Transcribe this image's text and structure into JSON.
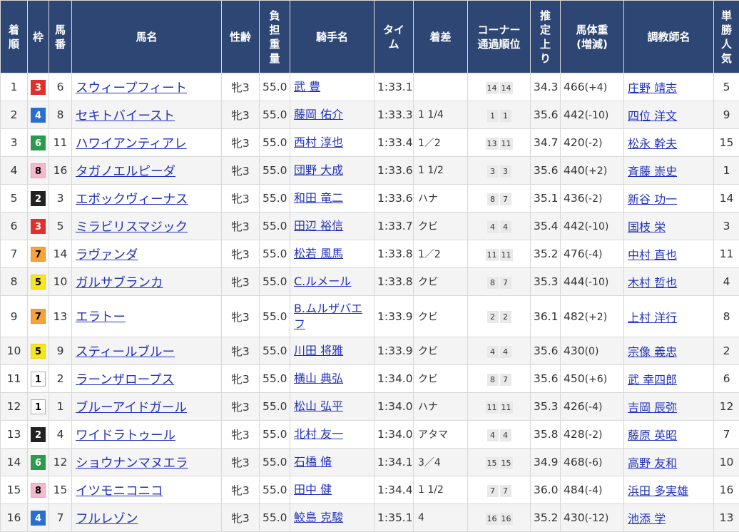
{
  "headers": {
    "rank": "着\n順",
    "waku": "枠",
    "umaban": "馬\n番",
    "horse": "馬名",
    "sexage": "性齢",
    "load": "負\n担\n重\n量",
    "jockey": "騎手名",
    "time": "タイ\nム",
    "margin": "着差",
    "corner": "コーナー\n通過順位",
    "last3f": "推\n定\n上\nり",
    "weight": "馬体重\n(増減)",
    "trainer": "調教師名",
    "pop": "単\n勝\n人\n気"
  },
  "rows": [
    {
      "rank": "1",
      "waku": "3",
      "umaban": "6",
      "horse": "スウィープフィート",
      "sexage": "牝3",
      "load": "55.0",
      "jockey": "武 豊",
      "time": "1:33.1",
      "margin": "",
      "c1": "14",
      "c2": "14",
      "last3f": "34.3",
      "weight": "466",
      "wdiff": "(+4)",
      "trainer": "庄野 靖志",
      "pop": "5"
    },
    {
      "rank": "2",
      "waku": "4",
      "umaban": "8",
      "horse": "セキトバイースト",
      "sexage": "牝3",
      "load": "55.0",
      "jockey": "藤岡 佑介",
      "time": "1:33.3",
      "margin": "1 1/4",
      "c1": "1",
      "c2": "1",
      "last3f": "35.6",
      "weight": "442",
      "wdiff": "(-10)",
      "trainer": "四位 洋文",
      "pop": "9"
    },
    {
      "rank": "3",
      "waku": "6",
      "umaban": "11",
      "horse": "ハワイアンティアレ",
      "sexage": "牝3",
      "load": "55.0",
      "jockey": "西村 淳也",
      "time": "1:33.4",
      "margin": "1／2",
      "c1": "13",
      "c2": "11",
      "last3f": "34.7",
      "weight": "420",
      "wdiff": "(-2)",
      "trainer": "松永 幹夫",
      "pop": "15"
    },
    {
      "rank": "4",
      "waku": "8",
      "umaban": "16",
      "horse": "タガノエルピーダ",
      "sexage": "牝3",
      "load": "55.0",
      "jockey": "団野 大成",
      "time": "1:33.6",
      "margin": "1 1/2",
      "c1": "3",
      "c2": "3",
      "last3f": "35.6",
      "weight": "440",
      "wdiff": "(+2)",
      "trainer": "斉藤 崇史",
      "pop": "1"
    },
    {
      "rank": "5",
      "waku": "2",
      "umaban": "3",
      "horse": "エボックヴィーナス",
      "sexage": "牝3",
      "load": "55.0",
      "jockey": "和田 竜二",
      "time": "1:33.6",
      "margin": "ハナ",
      "c1": "8",
      "c2": "7",
      "last3f": "35.1",
      "weight": "436",
      "wdiff": "(-2)",
      "trainer": "新谷 功一",
      "pop": "14"
    },
    {
      "rank": "6",
      "waku": "3",
      "umaban": "5",
      "horse": "ミラビリスマジック",
      "sexage": "牝3",
      "load": "55.0",
      "jockey": "田辺 裕信",
      "time": "1:33.7",
      "margin": "クビ",
      "c1": "4",
      "c2": "4",
      "last3f": "35.4",
      "weight": "442",
      "wdiff": "(-10)",
      "trainer": "国枝 栄",
      "pop": "3"
    },
    {
      "rank": "7",
      "waku": "7",
      "umaban": "14",
      "horse": "ラヴァンダ",
      "sexage": "牝3",
      "load": "55.0",
      "jockey": "松若 風馬",
      "time": "1:33.8",
      "margin": "1／2",
      "c1": "11",
      "c2": "11",
      "last3f": "35.2",
      "weight": "476",
      "wdiff": "(-4)",
      "trainer": "中村 直也",
      "pop": "11"
    },
    {
      "rank": "8",
      "waku": "5",
      "umaban": "10",
      "horse": "ガルサブランカ",
      "sexage": "牝3",
      "load": "55.0",
      "jockey": "C.ルメール",
      "time": "1:33.8",
      "margin": "クビ",
      "c1": "8",
      "c2": "7",
      "last3f": "35.3",
      "weight": "444",
      "wdiff": "(-10)",
      "trainer": "木村 哲也",
      "pop": "4"
    },
    {
      "rank": "9",
      "waku": "7",
      "umaban": "13",
      "horse": "エラトー",
      "sexage": "牝3",
      "load": "55.0",
      "jockey": "B.ムルザバエフ",
      "time": "1:33.9",
      "margin": "クビ",
      "c1": "2",
      "c2": "2",
      "last3f": "36.1",
      "weight": "482",
      "wdiff": "(+2)",
      "trainer": "上村 洋行",
      "pop": "8"
    },
    {
      "rank": "10",
      "waku": "5",
      "umaban": "9",
      "horse": "スティールブルー",
      "sexage": "牝3",
      "load": "55.0",
      "jockey": "川田 将雅",
      "time": "1:33.9",
      "margin": "クビ",
      "c1": "4",
      "c2": "4",
      "last3f": "35.6",
      "weight": "430",
      "wdiff": "(0)",
      "trainer": "宗像 義忠",
      "pop": "2"
    },
    {
      "rank": "11",
      "waku": "1",
      "umaban": "2",
      "horse": "ラーンザロープス",
      "sexage": "牝3",
      "load": "55.0",
      "jockey": "横山 典弘",
      "time": "1:34.0",
      "margin": "クビ",
      "c1": "8",
      "c2": "7",
      "last3f": "35.6",
      "weight": "450",
      "wdiff": "(+6)",
      "trainer": "武 幸四郎",
      "pop": "6"
    },
    {
      "rank": "12",
      "waku": "1",
      "umaban": "1",
      "horse": "ブルーアイドガール",
      "sexage": "牝3",
      "load": "55.0",
      "jockey": "松山 弘平",
      "time": "1:34.0",
      "margin": "ハナ",
      "c1": "11",
      "c2": "11",
      "last3f": "35.3",
      "weight": "426",
      "wdiff": "(-4)",
      "trainer": "吉岡 辰弥",
      "pop": "12"
    },
    {
      "rank": "13",
      "waku": "2",
      "umaban": "4",
      "horse": "ワイドラトゥール",
      "sexage": "牝3",
      "load": "55.0",
      "jockey": "北村 友一",
      "time": "1:34.0",
      "margin": "アタマ",
      "c1": "4",
      "c2": "4",
      "last3f": "35.8",
      "weight": "428",
      "wdiff": "(-2)",
      "trainer": "藤原 英昭",
      "pop": "7"
    },
    {
      "rank": "14",
      "waku": "6",
      "umaban": "12",
      "horse": "ショウナンマヌエラ",
      "sexage": "牝3",
      "load": "55.0",
      "jockey": "石橋 脩",
      "time": "1:34.1",
      "margin": "3／4",
      "c1": "15",
      "c2": "15",
      "last3f": "34.9",
      "weight": "468",
      "wdiff": "(-6)",
      "trainer": "高野 友和",
      "pop": "10"
    },
    {
      "rank": "15",
      "waku": "8",
      "umaban": "15",
      "horse": "イツモニコニコ",
      "sexage": "牝3",
      "load": "55.0",
      "jockey": "田中 健",
      "time": "1:34.4",
      "margin": "1 1/2",
      "c1": "7",
      "c2": "7",
      "last3f": "36.0",
      "weight": "484",
      "wdiff": "(-4)",
      "trainer": "浜田 多実雄",
      "pop": "16"
    },
    {
      "rank": "16",
      "waku": "4",
      "umaban": "7",
      "horse": "フルレゾン",
      "sexage": "牝3",
      "load": "55.0",
      "jockey": "鮫島 克駿",
      "time": "1:35.1",
      "margin": "4",
      "c1": "16",
      "c2": "16",
      "last3f": "35.2",
      "weight": "430",
      "wdiff": "(-12)",
      "trainer": "池添 学",
      "pop": "13"
    }
  ]
}
